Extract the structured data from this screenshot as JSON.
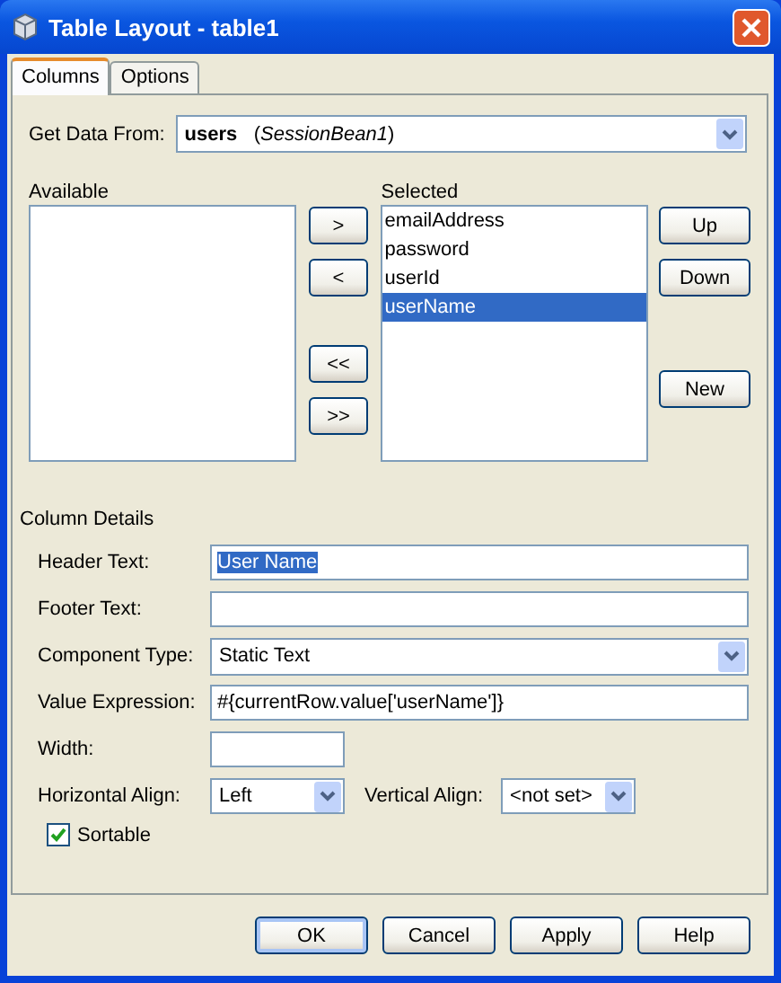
{
  "window": {
    "title": "Table Layout - table1"
  },
  "tabs": [
    {
      "label": "Columns",
      "selected": true
    },
    {
      "label": "Options",
      "selected": false
    }
  ],
  "data_source": {
    "label": "Get Data From:",
    "value": "**users**   (*SessionBean1*)"
  },
  "available": {
    "label": "Available"
  },
  "selected": {
    "label": "Selected",
    "items": [
      {
        "label": "emailAddress",
        "selected": false
      },
      {
        "label": "password",
        "selected": false
      },
      {
        "label": "userId",
        "selected": false
      },
      {
        "label": "userName",
        "selected": true
      }
    ]
  },
  "move_buttons": [
    ">",
    "<",
    "<<",
    ">>"
  ],
  "order_buttons": [
    "Up",
    "Down",
    "New"
  ],
  "column_details": {
    "title": "Column Details",
    "fields": [
      {
        "kind": "text",
        "label": "Header Text:",
        "value": "User Name",
        "highlighted": true
      },
      {
        "kind": "text",
        "label": "Footer Text:"
      },
      {
        "kind": "combo",
        "label": "Component Type:",
        "value": "Static Text",
        "highlighted": false
      },
      {
        "kind": "text",
        "label": "Value Expression:",
        "value": "#{currentRow.value['userName']}",
        "highlighted": false
      },
      {
        "kind": "short",
        "label": "Width:"
      }
    ],
    "horizontal_align": {
      "label": "Horizontal Align:",
      "value": "Left"
    },
    "vertical_align": {
      "label": "Vertical Align:",
      "value": "<not set>"
    },
    "sortable": {
      "label": "Sortable",
      "checked": true
    }
  },
  "buttons": [
    {
      "label": "OK",
      "default": true
    },
    {
      "label": "Cancel",
      "default": false
    },
    {
      "label": "Apply",
      "default": false
    },
    {
      "label": "Help",
      "default": false
    }
  ]
}
